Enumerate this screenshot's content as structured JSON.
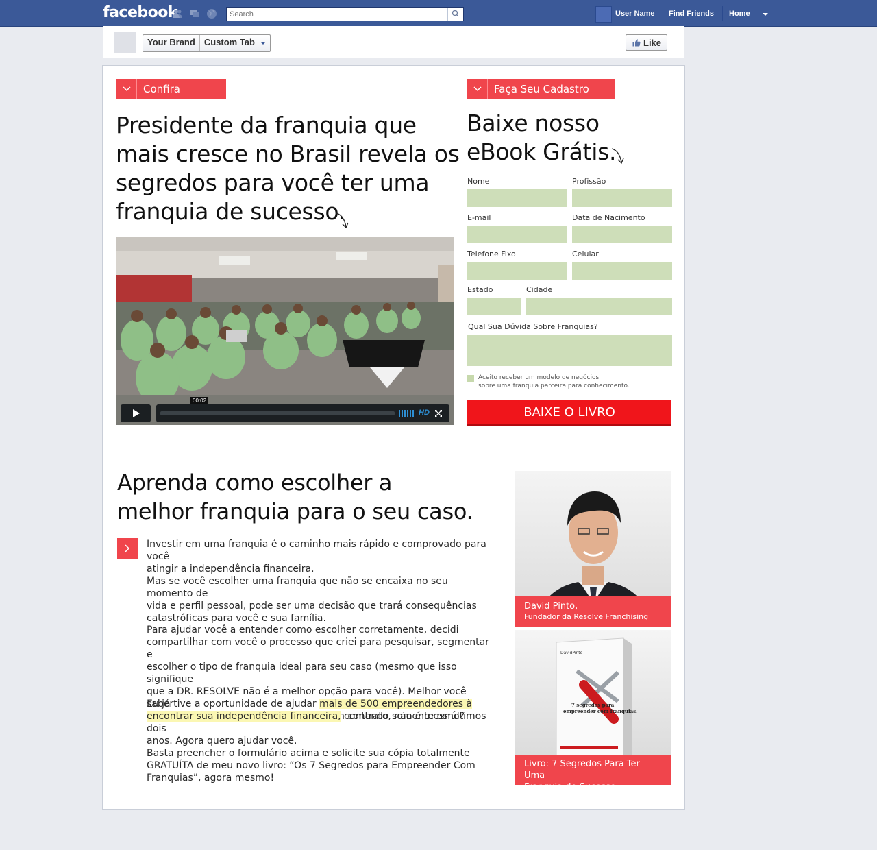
{
  "topbar": {
    "brand": "facebook",
    "search_placeholder": "Search",
    "user_name": "User Name",
    "find_friends": "Find Friends",
    "home": "Home"
  },
  "page_header": {
    "brand": "Your Brand",
    "tab": "Custom Tab",
    "like": "Like"
  },
  "left": {
    "tag": "Confira",
    "headline": [
      "Presidente da franquia que",
      "mais cresce no Brasil revela os",
      "segredos para você ter uma",
      "franquia de sucesso."
    ],
    "video_time": "00:02",
    "video_hd": "HD"
  },
  "form": {
    "tag": "Faça Seu Cadastro",
    "headline": [
      "Baixe nosso",
      "eBook Grátis."
    ],
    "labels": {
      "nome": "Nome",
      "profissao": "Profissão",
      "email": "E-mail",
      "nascimento": "Data de Nacimento",
      "telefone": "Telefone Fixo",
      "celular": "Celular",
      "estado": "Estado",
      "cidade": "Cidade",
      "duvida": "Qual Sua Dúvida Sobre Franquias?"
    },
    "consent": [
      "Aceito receber um modelo de negócios",
      "sobre uma franquia parceira para conhecimento."
    ],
    "submit": "BAIXE O LIVRO"
  },
  "section": {
    "headline": [
      "Aprenda como escolher a",
      "melhor franquia para o seu caso."
    ],
    "p1": [
      "Investir em uma franquia é o caminho mais rápido e comprovado para você",
      "atingir a independência financeira."
    ],
    "p2": [
      "Mas se você escolher uma franquia que não se encaixa no seu momento de",
      "vida e perfil pessoal, pode ser uma decisão que trará consequências",
      "catastróficas para você e sua família."
    ],
    "p3": [
      "Para ajudar você a entender como escolher corretamente, decidi",
      "compartilhar com você o processo que criei para pesquisar, segmentar e",
      "escolher o tipo de franquia ideal para seu caso (mesmo que isso signifique",
      "que a DR. RESOLVE não é a melhor opção para você). Melhor você saber",
      "disso agora do que após ter assinado um contrato, não é mesmo?"
    ],
    "p4_a": "Eu já tive a oportunidade de ajudar ",
    "p4_hl1": "mais de 500 empreendedores à",
    "p4_hl2": "encontrar sua independência financeira,",
    "p4_b": " contando somente os últimos dois",
    "p4_c": "anos. Agora quero ajudar você.",
    "p5": [
      "Basta preencher o formulário acima e solicite sua cópia totalmente",
      "GRATUÍTA de meu novo livro: “Os 7 Segredos para Empreender Com",
      "Franquias”, agora mesmo!"
    ]
  },
  "sidebar": {
    "author_name": "David Pinto,",
    "author_role": "Fundador da Resolve Franchising",
    "book_caption": [
      "Livro: 7 Segredos Para Ter Uma",
      "Franquia de Sucesso"
    ],
    "book_title": [
      "7 segredos para",
      "empreender com franquias."
    ],
    "book_author": "DavidPinto"
  },
  "colors": {
    "facebook_blue": "#3b5998",
    "accent_red": "#f0454c",
    "button_red": "#f0151b",
    "field_green": "#cedeb9",
    "highlight_yellow": "#fbf7b3"
  }
}
